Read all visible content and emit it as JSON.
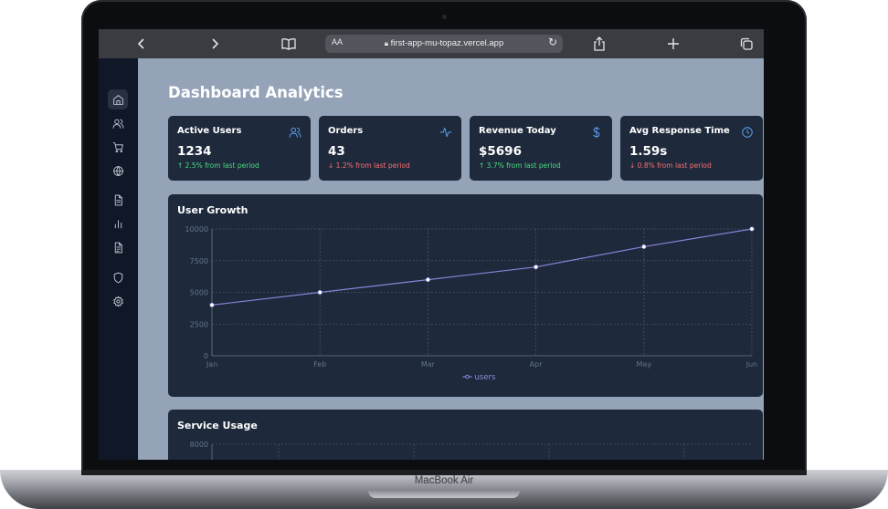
{
  "device": {
    "label": "MacBook Air"
  },
  "browser": {
    "text_size_label": "AA",
    "url": "first-app-mu-topaz.vercel.app"
  },
  "sidebar": {
    "items": [
      {
        "icon": "home-icon",
        "active": true
      },
      {
        "icon": "users-icon"
      },
      {
        "icon": "shopping-cart-icon"
      },
      {
        "icon": "globe-icon"
      },
      {
        "icon": "document-icon"
      },
      {
        "icon": "bar-chart-icon"
      },
      {
        "icon": "file-text-icon"
      },
      {
        "icon": "shield-icon"
      },
      {
        "icon": "settings-icon"
      }
    ]
  },
  "dashboard": {
    "title": "Dashboard Analytics",
    "cards": [
      {
        "title": "Active Users",
        "value": "1234",
        "change": "↑ 2.5% from last period",
        "trend": "up",
        "icon": "users-icon"
      },
      {
        "title": "Orders",
        "value": "43",
        "change": "↓ 1.2% from last period",
        "trend": "down",
        "icon": "activity-icon"
      },
      {
        "title": "Revenue Today",
        "value": "$5696",
        "change": "↑ 3.7% from last period",
        "trend": "up",
        "icon": "dollar-icon"
      },
      {
        "title": "Avg Response Time",
        "value": "1.59s",
        "change": "↓ 0.8% from last period",
        "trend": "down",
        "icon": "clock-icon"
      }
    ]
  },
  "chart_data": [
    {
      "type": "line",
      "title": "User Growth",
      "categories": [
        "Jan",
        "Feb",
        "Mar",
        "Apr",
        "May",
        "Jun"
      ],
      "series": [
        {
          "name": "users",
          "values": [
            4000,
            5000,
            6000,
            7000,
            8600,
            10000
          ],
          "color": "#8884d8"
        }
      ],
      "yticks": [
        0,
        2500,
        5000,
        7500,
        10000
      ],
      "ylim": [
        0,
        10000
      ],
      "grid": true,
      "legend": "bottom-center"
    },
    {
      "type": "bar",
      "title": "Service Usage",
      "yticks": [
        8000
      ],
      "ylim": [
        0,
        8000
      ],
      "grid": true
    }
  ],
  "colors": {
    "screen_bg": "#94a3b8",
    "card_bg": "#1e293b",
    "sidebar_bg": "#101828",
    "accent_icon": "#60a5fa",
    "up": "#4ade80",
    "down": "#f87171"
  }
}
